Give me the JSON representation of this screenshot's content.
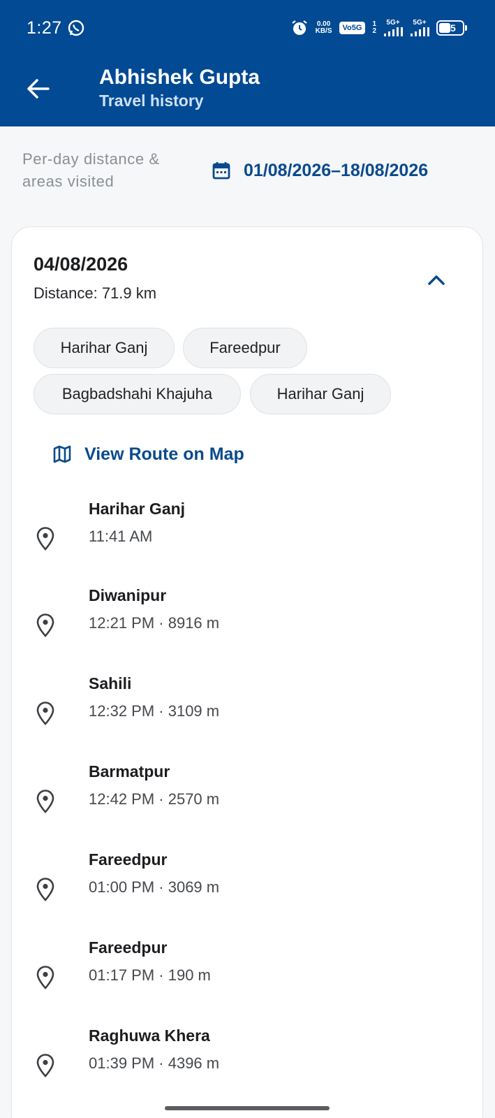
{
  "status_bar": {
    "time": "1:27",
    "net_speed_top": "0.00",
    "net_speed_unit": "KB/S",
    "volte": "Vo5G",
    "sim_slots_top": "1",
    "sim_slots_bottom": "2",
    "signal1_label": "5G+",
    "signal2_label": "5G+",
    "battery": "45"
  },
  "app_bar": {
    "title": "Abhishek Gupta",
    "subtitle": "Travel history"
  },
  "range": {
    "description": "Per-day distance & areas visited",
    "dates": "01/08/2026–18/08/2026"
  },
  "day": {
    "date": "04/08/2026",
    "distance": "Distance: 71.9 km",
    "areas": [
      "Harihar Ganj",
      "Fareedpur",
      "Bagbadshahi Khajuha",
      "Harihar Ganj"
    ],
    "view_route_label": "View Route on Map",
    "stops": [
      {
        "name": "Harihar Ganj",
        "meta": "11:41 AM"
      },
      {
        "name": "Diwanipur",
        "meta": "12:21 PM · 8916 m"
      },
      {
        "name": "Sahili",
        "meta": "12:32 PM · 3109 m"
      },
      {
        "name": "Barmatpur",
        "meta": "12:42 PM · 2570 m"
      },
      {
        "name": "Fareedpur",
        "meta": "01:00 PM · 3069 m"
      },
      {
        "name": "Fareedpur",
        "meta": "01:17 PM · 190 m"
      },
      {
        "name": "Raghuwa Khera",
        "meta": "01:39 PM · 4396 m"
      }
    ]
  },
  "colors": {
    "app_bar": "#024a94",
    "accent": "#0a4a8c",
    "background": "#f5f7f9"
  }
}
